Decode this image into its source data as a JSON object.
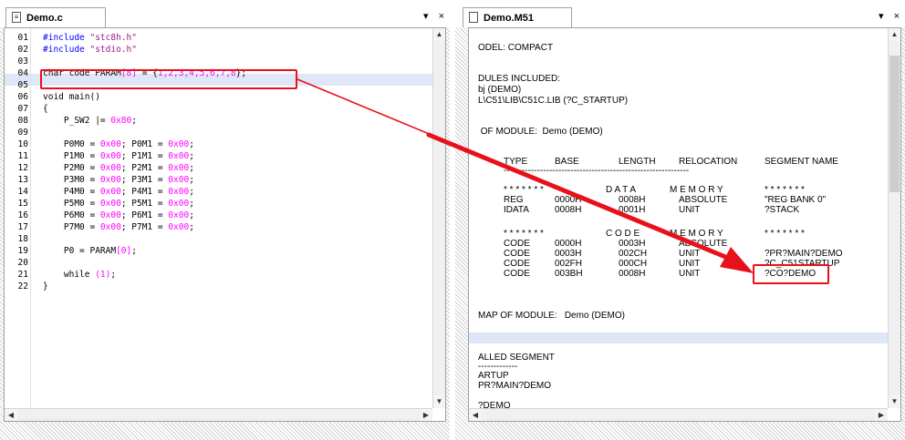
{
  "left": {
    "tab_label": "Demo.c",
    "tab_icon": "c-file-icon",
    "menu_glyph": "▾",
    "close_glyph": "×",
    "lines": [
      {
        "n": "01",
        "parts": [
          {
            "t": "#include ",
            "c": "kw"
          },
          {
            "t": "\"stc8h.h\"",
            "c": "str"
          }
        ]
      },
      {
        "n": "02",
        "parts": [
          {
            "t": "#include ",
            "c": "kw"
          },
          {
            "t": "\"stdio.h\"",
            "c": "str"
          }
        ]
      },
      {
        "n": "03",
        "parts": []
      },
      {
        "n": "04",
        "parts": [
          {
            "t": "char code PARAM",
            "c": ""
          },
          {
            "t": "[8]",
            "c": "num"
          },
          {
            "t": " = {",
            "c": ""
          },
          {
            "t": "1,2,3,4,5,6,7,8",
            "c": "num"
          },
          {
            "t": "};",
            "c": ""
          }
        ]
      },
      {
        "n": "05",
        "parts": []
      },
      {
        "n": "06",
        "parts": [
          {
            "t": "void main()",
            "c": ""
          }
        ]
      },
      {
        "n": "07",
        "parts": [
          {
            "t": "{",
            "c": ""
          }
        ]
      },
      {
        "n": "08",
        "parts": [
          {
            "t": "    P_SW2 |= ",
            "c": ""
          },
          {
            "t": "0x80",
            "c": "num"
          },
          {
            "t": ";",
            "c": ""
          }
        ]
      },
      {
        "n": "09",
        "parts": []
      },
      {
        "n": "10",
        "parts": [
          {
            "t": "    P0M0 = ",
            "c": ""
          },
          {
            "t": "0x00",
            "c": "num"
          },
          {
            "t": "; P0M1 = ",
            "c": ""
          },
          {
            "t": "0x00",
            "c": "num"
          },
          {
            "t": ";",
            "c": ""
          }
        ]
      },
      {
        "n": "11",
        "parts": [
          {
            "t": "    P1M0 = ",
            "c": ""
          },
          {
            "t": "0x00",
            "c": "num"
          },
          {
            "t": "; P1M1 = ",
            "c": ""
          },
          {
            "t": "0x00",
            "c": "num"
          },
          {
            "t": ";",
            "c": ""
          }
        ]
      },
      {
        "n": "12",
        "parts": [
          {
            "t": "    P2M0 = ",
            "c": ""
          },
          {
            "t": "0x00",
            "c": "num"
          },
          {
            "t": "; P2M1 = ",
            "c": ""
          },
          {
            "t": "0x00",
            "c": "num"
          },
          {
            "t": ";",
            "c": ""
          }
        ]
      },
      {
        "n": "13",
        "parts": [
          {
            "t": "    P3M0 = ",
            "c": ""
          },
          {
            "t": "0x00",
            "c": "num"
          },
          {
            "t": "; P3M1 = ",
            "c": ""
          },
          {
            "t": "0x00",
            "c": "num"
          },
          {
            "t": ";",
            "c": ""
          }
        ]
      },
      {
        "n": "14",
        "parts": [
          {
            "t": "    P4M0 = ",
            "c": ""
          },
          {
            "t": "0x00",
            "c": "num"
          },
          {
            "t": "; P4M1 = ",
            "c": ""
          },
          {
            "t": "0x00",
            "c": "num"
          },
          {
            "t": ";",
            "c": ""
          }
        ]
      },
      {
        "n": "15",
        "parts": [
          {
            "t": "    P5M0 = ",
            "c": ""
          },
          {
            "t": "0x00",
            "c": "num"
          },
          {
            "t": "; P5M1 = ",
            "c": ""
          },
          {
            "t": "0x00",
            "c": "num"
          },
          {
            "t": ";",
            "c": ""
          }
        ]
      },
      {
        "n": "16",
        "parts": [
          {
            "t": "    P6M0 = ",
            "c": ""
          },
          {
            "t": "0x00",
            "c": "num"
          },
          {
            "t": "; P6M1 = ",
            "c": ""
          },
          {
            "t": "0x00",
            "c": "num"
          },
          {
            "t": ";",
            "c": ""
          }
        ]
      },
      {
        "n": "17",
        "parts": [
          {
            "t": "    P7M0 = ",
            "c": ""
          },
          {
            "t": "0x00",
            "c": "num"
          },
          {
            "t": "; P7M1 = ",
            "c": ""
          },
          {
            "t": "0x00",
            "c": "num"
          },
          {
            "t": ";",
            "c": ""
          }
        ]
      },
      {
        "n": "18",
        "parts": []
      },
      {
        "n": "19",
        "parts": [
          {
            "t": "    P0 = PARAM",
            "c": ""
          },
          {
            "t": "[0]",
            "c": "num"
          },
          {
            "t": ";",
            "c": ""
          }
        ]
      },
      {
        "n": "20",
        "parts": []
      },
      {
        "n": "21",
        "parts": [
          {
            "t": "    while ",
            "c": ""
          },
          {
            "t": "(1)",
            "c": "num"
          },
          {
            "t": ";",
            "c": ""
          }
        ]
      },
      {
        "n": "22",
        "parts": [
          {
            "t": "}",
            "c": ""
          }
        ]
      }
    ]
  },
  "right": {
    "tab_label": "Demo.M51",
    "tab_icon": "file-icon",
    "menu_glyph": "▾",
    "close_glyph": "×",
    "model_line": "ODEL: COMPACT",
    "modules_header": "DULES INCLUDED:",
    "modules": [
      "bj (DEMO)",
      "L\\C51\\LIB\\C51C.LIB (?C_STARTUP)"
    ],
    "of_module_line": " OF MODULE:  Demo (DEMO)",
    "columns": [
      "TYPE",
      "BASE",
      "LENGTH",
      "RELOCATION",
      "SEGMENT NAME"
    ],
    "rule": "-------------------------------------------------------------",
    "data_banner": [
      "* * * * * * *",
      "D A T A",
      "M E M O R Y",
      "* * * * * * *"
    ],
    "data_rows": [
      [
        "REG",
        "0000H",
        "0008H",
        "ABSOLUTE",
        "\"REG BANK 0\""
      ],
      [
        "IDATA",
        "0008H",
        "0001H",
        "UNIT",
        "?STACK"
      ]
    ],
    "code_banner": [
      "* * * * * * *",
      "C O D E",
      "M E M O R Y",
      "* * * * * * *"
    ],
    "code_rows": [
      [
        "CODE",
        "0000H",
        "0003H",
        "ABSOLUTE",
        ""
      ],
      [
        "CODE",
        "0003H",
        "002CH",
        "UNIT",
        "?PR?MAIN?DEMO"
      ],
      [
        "CODE",
        "002FH",
        "000CH",
        "UNIT",
        "?C_C51STARTUP"
      ],
      [
        "CODE",
        "003BH",
        "0008H",
        "UNIT",
        "?CO?DEMO"
      ]
    ],
    "map_line": "MAP OF MODULE:   Demo (DEMO)",
    "called_header": "ALLED SEGMENT",
    "called_rule": "-------------",
    "called_items": [
      "ARTUP",
      "PR?MAIN?DEMO",
      "",
      "?DEMO"
    ]
  },
  "colors": {
    "annotation": "#e8101a",
    "keyword": "#0000ff",
    "string": "#a0148c",
    "number": "#ff00ff",
    "highlight": "#dfe6f7"
  }
}
